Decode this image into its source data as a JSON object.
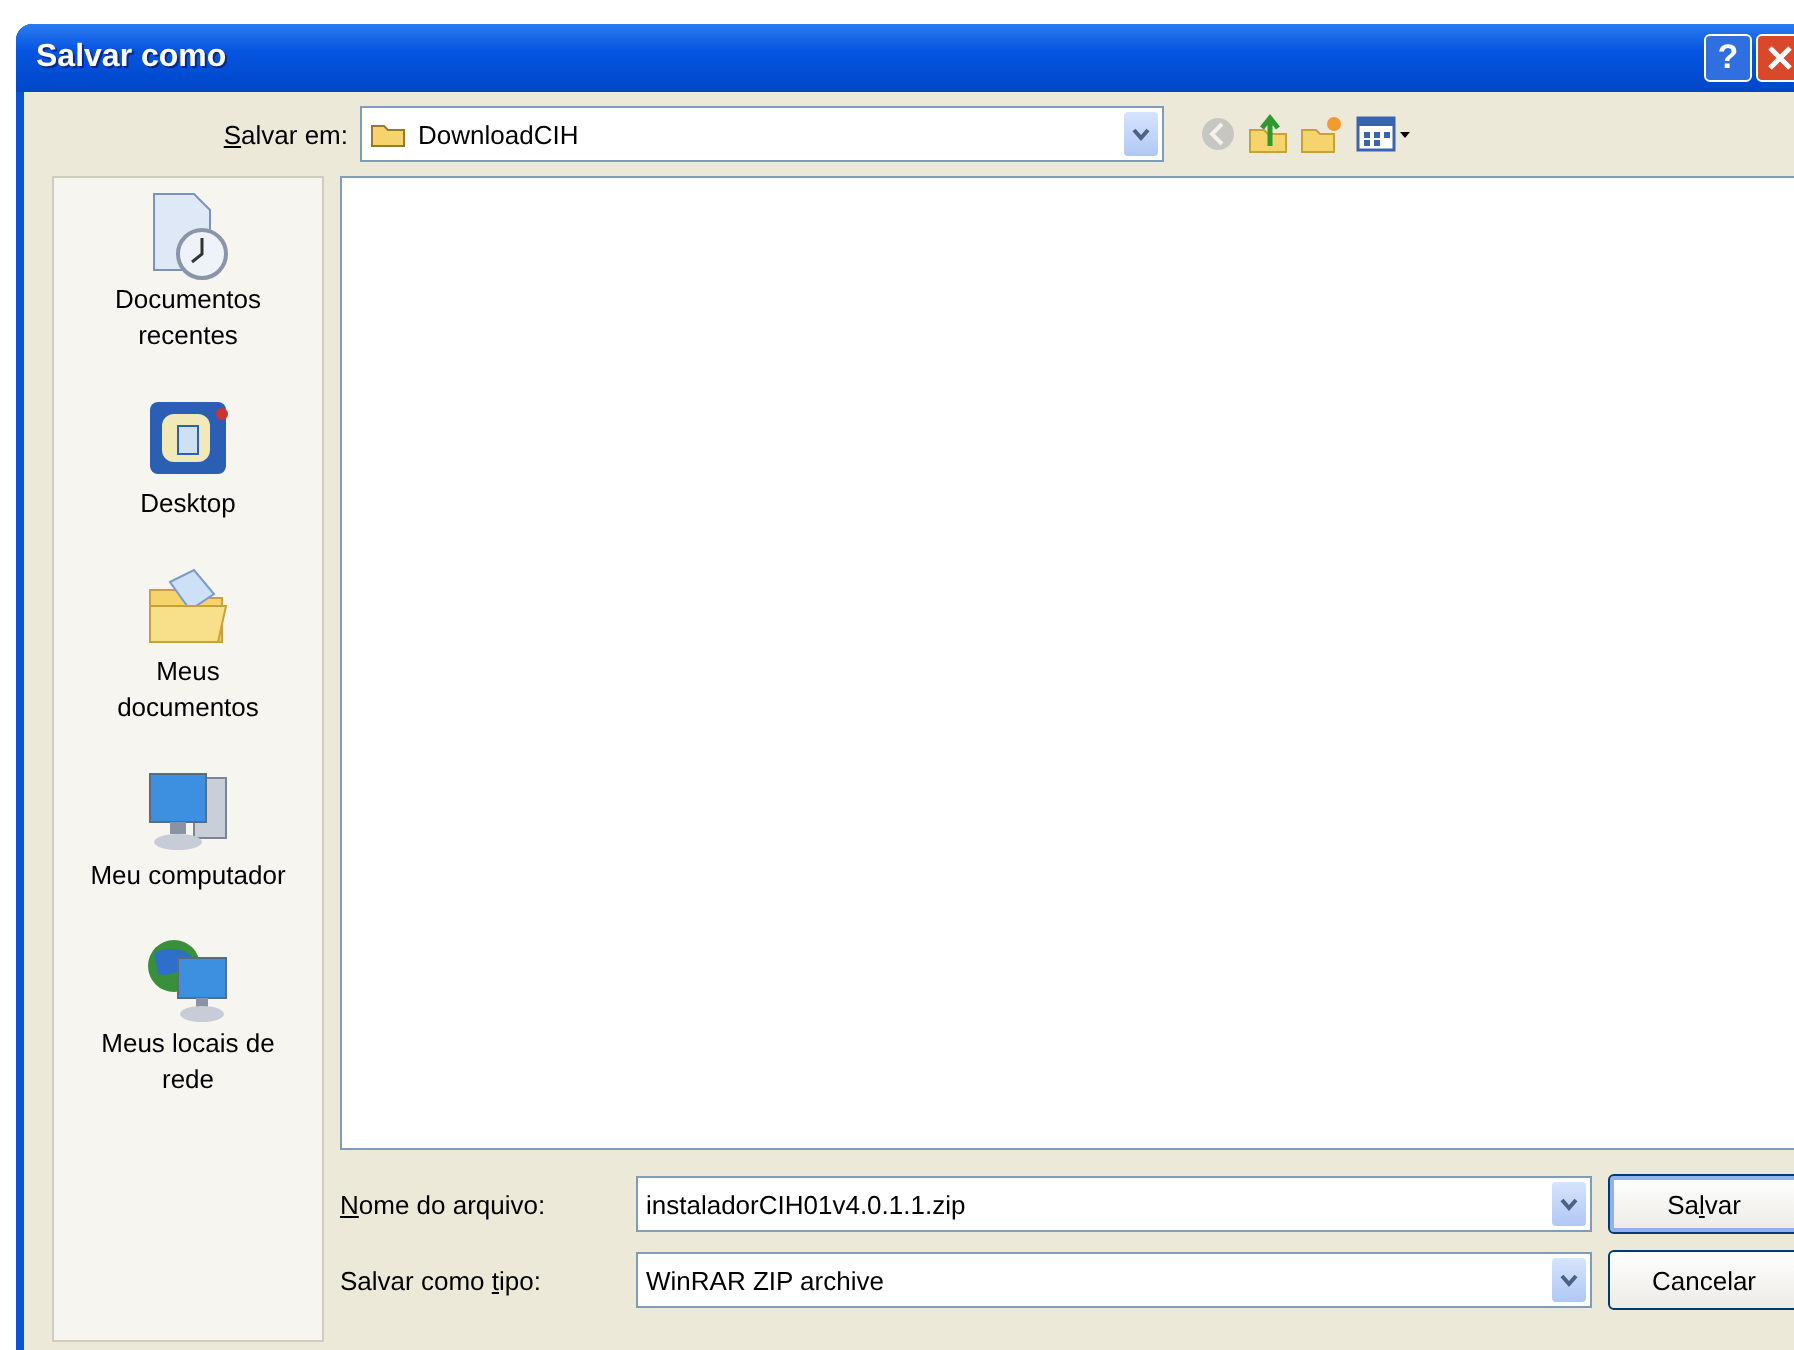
{
  "window": {
    "title": "Salvar como",
    "help": "?"
  },
  "save_in": {
    "label": {
      "key": "S",
      "after": "alvar em:"
    },
    "value": "DownloadCIH"
  },
  "toolbar": [
    {
      "kind": "back",
      "disabled": true
    },
    {
      "kind": "up",
      "disabled": false
    },
    {
      "kind": "new-folder",
      "disabled": false
    },
    {
      "kind": "view-menu",
      "disabled": false
    }
  ],
  "places": [
    {
      "label": "Documentos recentes",
      "kind": "recent"
    },
    {
      "label": "Desktop",
      "kind": "desktop"
    },
    {
      "label": "Meus documentos",
      "kind": "documents"
    },
    {
      "label": "Meu computador",
      "kind": "computer"
    },
    {
      "label": "Meus locais de rede",
      "kind": "network"
    }
  ],
  "file_name": {
    "label": {
      "key": "N",
      "after": "ome do arquivo:"
    },
    "value": "instaladorCIH01v4.0.1.1.zip"
  },
  "file_type": {
    "label": {
      "before": "Salvar como ",
      "key": "t",
      "after": "ipo:"
    },
    "value": "WinRAR ZIP archive"
  },
  "buttons": [
    {
      "label": {
        "before": "Sa",
        "key": "l",
        "after": "var"
      },
      "default": true
    },
    {
      "label": {
        "before": "Cancelar"
      },
      "default": false
    }
  ]
}
